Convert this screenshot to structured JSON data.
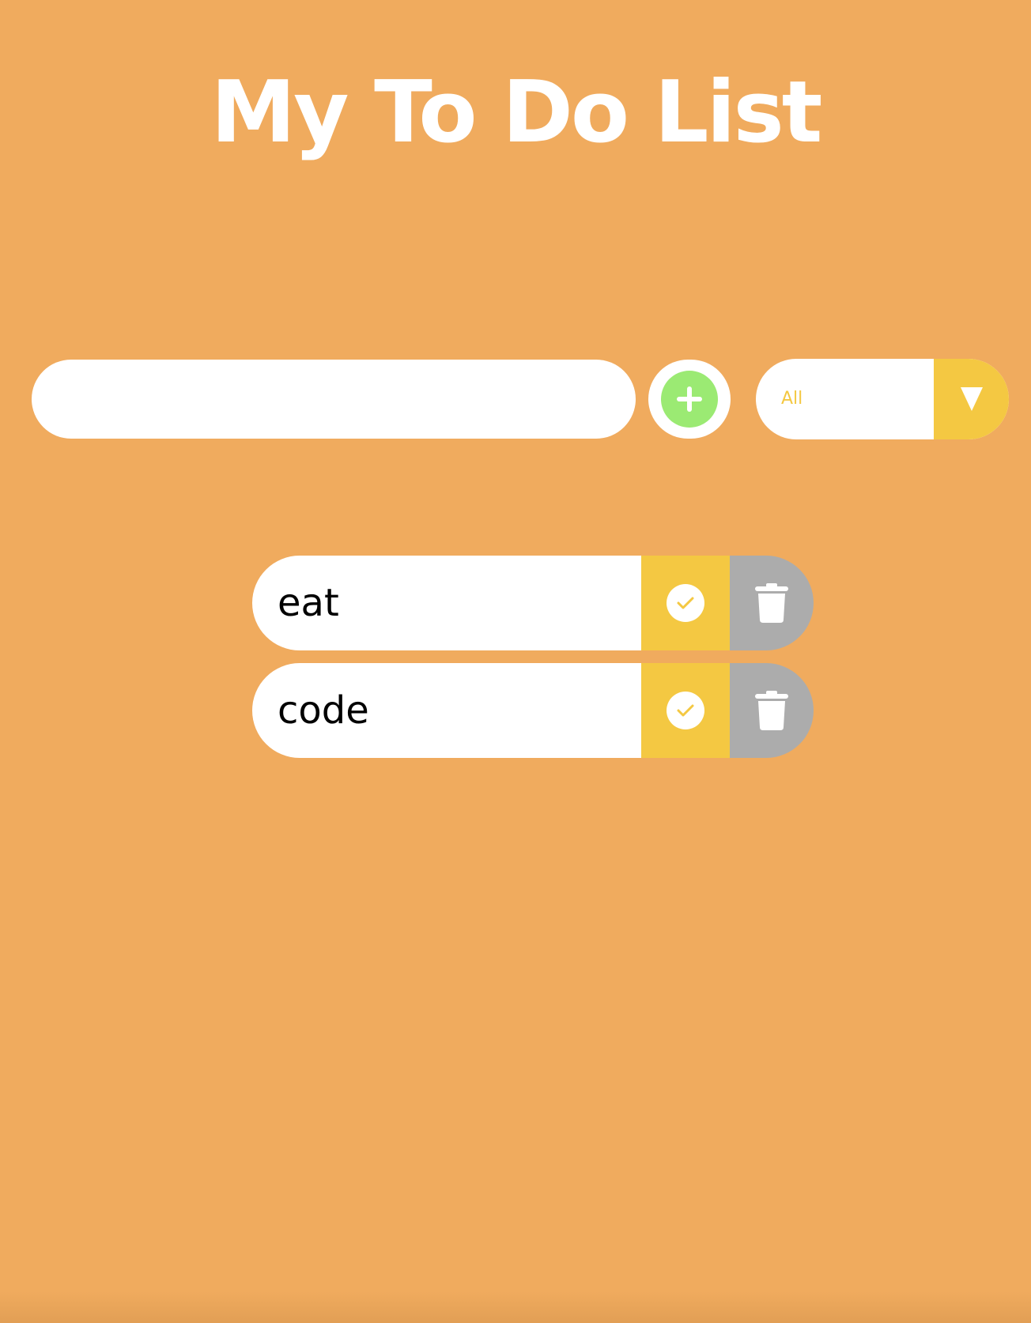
{
  "page": {
    "title": "My To Do List",
    "background_color": "#f0ab5e"
  },
  "form": {
    "input_value": "",
    "add_icon": "plus-icon",
    "add_icon_color": "#9bea73",
    "filter": {
      "selected": "All",
      "accent_color": "#f4c842",
      "arrow_icon": "triangle-down-icon"
    }
  },
  "todos": [
    {
      "text": "eat"
    },
    {
      "text": "code"
    }
  ],
  "actions": {
    "complete_icon": "check-circle-icon",
    "delete_icon": "trash-icon",
    "complete_color": "#f4c842",
    "delete_color": "#acacac"
  }
}
